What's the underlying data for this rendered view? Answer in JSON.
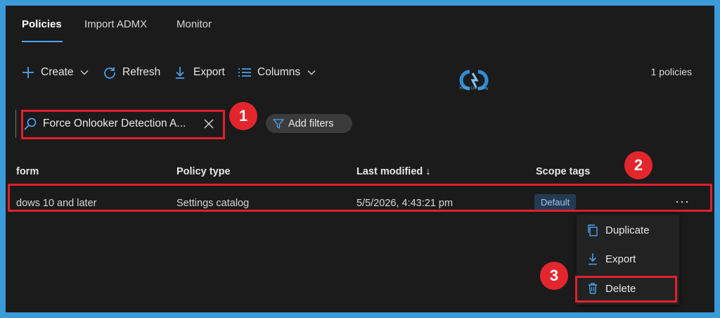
{
  "tabs": [
    {
      "label": "Policies",
      "active": true
    },
    {
      "label": "Import ADMX",
      "active": false
    },
    {
      "label": "Monitor",
      "active": false
    }
  ],
  "toolbar": {
    "create_label": "Create",
    "refresh_label": "Refresh",
    "export_label": "Export",
    "columns_label": "Columns",
    "policy_count": "1 policies"
  },
  "logo": {
    "text": "HTMD Community"
  },
  "search": {
    "value": "Force Onlooker Detection A..."
  },
  "filters": {
    "add_label": "Add filters"
  },
  "callouts": [
    "1",
    "2",
    "3"
  ],
  "table": {
    "columns": [
      "form",
      "Policy type",
      "Last modified ↓",
      "Scope tags"
    ],
    "rows": [
      {
        "platform": "dows 10 and later",
        "policy_type": "Settings catalog",
        "last_modified": "5/5/2026, 4:43:21 pm",
        "scope_tag": "Default",
        "more": "···"
      }
    ]
  },
  "context_menu": {
    "items": [
      {
        "label": "Duplicate",
        "icon": "duplicate-icon"
      },
      {
        "label": "Export",
        "icon": "download-icon"
      },
      {
        "label": "Delete",
        "icon": "trash-icon"
      }
    ]
  },
  "colors": {
    "frame": "#3a9bd9",
    "background": "#1b1b1b",
    "accent": "#4aa3f0",
    "highlight_red": "#e0202e"
  }
}
